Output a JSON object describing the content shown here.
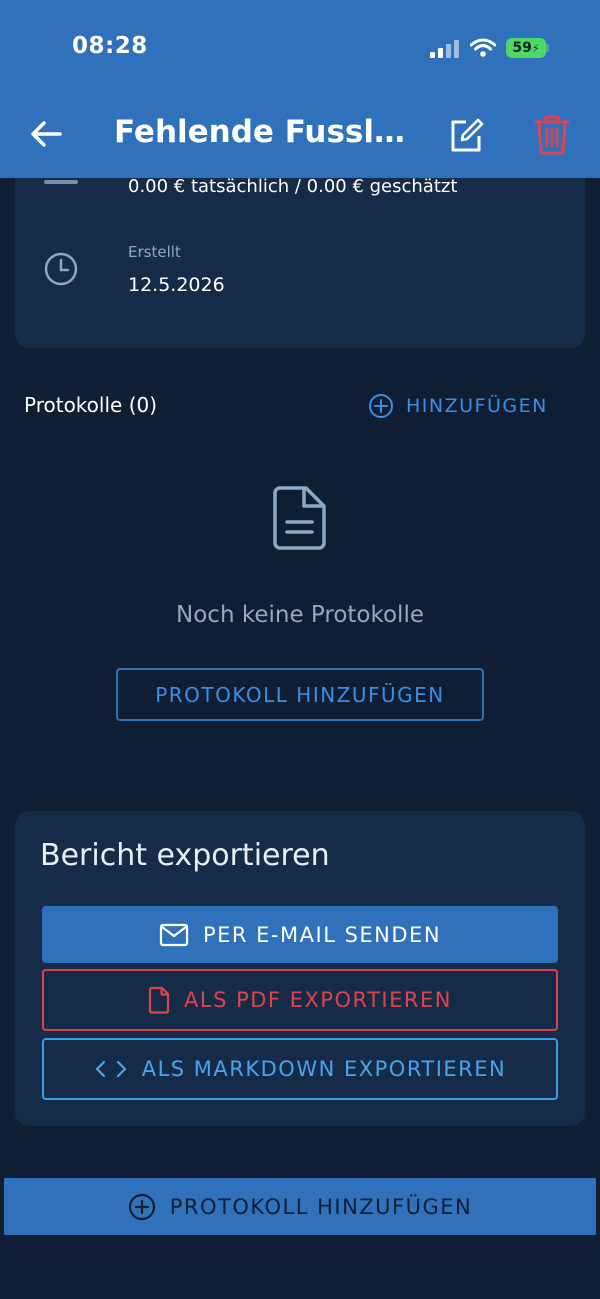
{
  "status_bar": {
    "time": "08:28",
    "battery": "59"
  },
  "nav": {
    "title": "Fehlende Fussl…"
  },
  "info": {
    "cost": "0.00 € tatsächlich / 0.00 € geschätzt",
    "created_label": "Erstellt",
    "created_date": "12.5.2026"
  },
  "protocols": {
    "title": "Protokolle (0)",
    "add_link": "HINZUFÜGEN",
    "empty_text": "Noch keine Protokolle",
    "add_button": "PROTOKOLL HINZUFÜGEN"
  },
  "export": {
    "title": "Bericht exportieren",
    "email": "PER E-MAIL SENDEN",
    "pdf": "ALS PDF EXPORTIEREN",
    "markdown": "ALS MARKDOWN EXPORTIEREN"
  },
  "bottom": {
    "add_button": "PROTOKOLL HINZUFÜGEN"
  },
  "colors": {
    "background": "#0f1e33",
    "card": "#162b47",
    "primary": "#2f72bb",
    "danger": "#e0434d",
    "muted": "#93a8c2"
  },
  "icons": [
    "back-arrow-icon",
    "edit-icon",
    "trash-icon",
    "clock-icon",
    "plus-circle-icon",
    "document-icon",
    "mail-icon",
    "file-icon",
    "code-icon"
  ]
}
